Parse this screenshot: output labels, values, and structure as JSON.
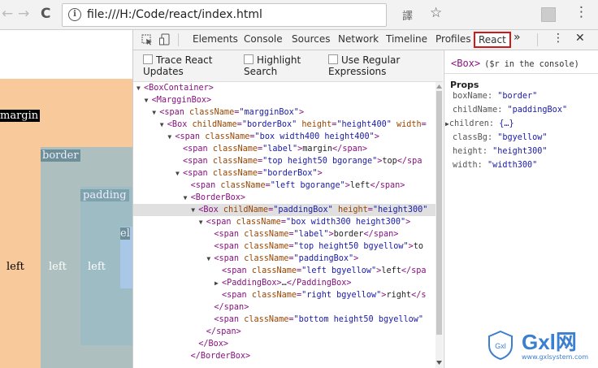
{
  "browser": {
    "back": "←",
    "forward": "→",
    "reload": "C",
    "info": "i",
    "url": "file:///H:/Code/react/index.html",
    "translate": "譯",
    "star": "☆",
    "menu": "⋮"
  },
  "page": {
    "margin_label": "margin",
    "border_label": "border",
    "padding_label": "padding",
    "partial_label": "el",
    "left1": "left",
    "left2": "left",
    "left3": "left",
    "colors": {
      "orange": "#f8c99a",
      "slate": "#9dbcc4",
      "blue": "#a9c8e8"
    }
  },
  "devtools": {
    "tabs": [
      "Elements",
      "Console",
      "Sources",
      "Network",
      "Timeline",
      "Profiles",
      "React"
    ],
    "more": "»",
    "kebab": "⋮",
    "close": "✕",
    "options": [
      {
        "line1": "Trace React",
        "line2": "Updates"
      },
      {
        "line1": "Highlight",
        "line2": "Search"
      },
      {
        "line1": "Use Regular",
        "line2": "Expressions"
      }
    ],
    "tree": [
      {
        "i": 0,
        "arrow": "▼",
        "p": [
          [
            "t",
            "<BoxContainer>"
          ]
        ]
      },
      {
        "i": 1,
        "arrow": "▼",
        "p": [
          [
            "t",
            "<MargginBox>"
          ]
        ]
      },
      {
        "i": 2,
        "arrow": "▼",
        "p": [
          [
            "t",
            "<span "
          ],
          [
            "a",
            "className"
          ],
          [
            "t",
            "="
          ],
          [
            "v",
            "\"margginBox\""
          ],
          [
            "t",
            ">"
          ]
        ]
      },
      {
        "i": 3,
        "arrow": "▼",
        "p": [
          [
            "t",
            "<Box "
          ],
          [
            "a",
            "childName"
          ],
          [
            "t",
            "="
          ],
          [
            "v",
            "\"borderBox\""
          ],
          [
            "t",
            " "
          ],
          [
            "a",
            "height"
          ],
          [
            "t",
            "="
          ],
          [
            "v",
            "\"height400\""
          ],
          [
            "t",
            " "
          ],
          [
            "a",
            "width"
          ],
          [
            "t",
            "="
          ]
        ]
      },
      {
        "i": 4,
        "arrow": "▼",
        "p": [
          [
            "t",
            "<span "
          ],
          [
            "a",
            "className"
          ],
          [
            "t",
            "="
          ],
          [
            "v",
            "\"box width400 height400\""
          ],
          [
            "t",
            ">"
          ]
        ]
      },
      {
        "i": 5,
        "arrow": "",
        "p": [
          [
            "t",
            "<span "
          ],
          [
            "a",
            "className"
          ],
          [
            "t",
            "="
          ],
          [
            "v",
            "\"label\""
          ],
          [
            "t",
            ">"
          ],
          [
            "x",
            "margin"
          ],
          [
            "t",
            "</span>"
          ]
        ]
      },
      {
        "i": 5,
        "arrow": "",
        "p": [
          [
            "t",
            "<span "
          ],
          [
            "a",
            "className"
          ],
          [
            "t",
            "="
          ],
          [
            "v",
            "\"top height50 bgorange\""
          ],
          [
            "t",
            ">"
          ],
          [
            "x",
            "top"
          ],
          [
            "t",
            "</spa"
          ]
        ]
      },
      {
        "i": 5,
        "arrow": "▼",
        "p": [
          [
            "t",
            "<span "
          ],
          [
            "a",
            "className"
          ],
          [
            "t",
            "="
          ],
          [
            "v",
            "\"borderBox\""
          ],
          [
            "t",
            ">"
          ]
        ]
      },
      {
        "i": 6,
        "arrow": "",
        "p": [
          [
            "t",
            "<span "
          ],
          [
            "a",
            "className"
          ],
          [
            "t",
            "="
          ],
          [
            "v",
            "\"left bgorange\""
          ],
          [
            "t",
            ">"
          ],
          [
            "x",
            "left"
          ],
          [
            "t",
            "</span>"
          ]
        ]
      },
      {
        "i": 6,
        "arrow": "▼",
        "p": [
          [
            "t",
            "<BorderBox>"
          ]
        ]
      },
      {
        "i": 7,
        "arrow": "▼",
        "sel": true,
        "p": [
          [
            "t",
            "<Box "
          ],
          [
            "a",
            "childName"
          ],
          [
            "t",
            "="
          ],
          [
            "v",
            "\"paddingBox\""
          ],
          [
            "t",
            " "
          ],
          [
            "a",
            "height"
          ],
          [
            "t",
            "="
          ],
          [
            "v",
            "\"height300\""
          ]
        ]
      },
      {
        "i": 8,
        "arrow": "▼",
        "p": [
          [
            "t",
            "<span "
          ],
          [
            "a",
            "className"
          ],
          [
            "t",
            "="
          ],
          [
            "v",
            "\"box width300 height300\""
          ],
          [
            "t",
            ">"
          ]
        ]
      },
      {
        "i": 9,
        "arrow": "",
        "p": [
          [
            "t",
            "<span "
          ],
          [
            "a",
            "className"
          ],
          [
            "t",
            "="
          ],
          [
            "v",
            "\"label\""
          ],
          [
            "t",
            ">"
          ],
          [
            "x",
            "border"
          ],
          [
            "t",
            "</span>"
          ]
        ]
      },
      {
        "i": 9,
        "arrow": "",
        "p": [
          [
            "t",
            "<span "
          ],
          [
            "a",
            "className"
          ],
          [
            "t",
            "="
          ],
          [
            "v",
            "\"top height50 bgyellow\""
          ],
          [
            "t",
            ">"
          ],
          [
            "x",
            "to"
          ]
        ]
      },
      {
        "i": 9,
        "arrow": "▼",
        "p": [
          [
            "t",
            "<span "
          ],
          [
            "a",
            "className"
          ],
          [
            "t",
            "="
          ],
          [
            "v",
            "\"paddingBox\""
          ],
          [
            "t",
            ">"
          ]
        ]
      },
      {
        "i": 10,
        "arrow": "",
        "p": [
          [
            "t",
            "<span "
          ],
          [
            "a",
            "className"
          ],
          [
            "t",
            "="
          ],
          [
            "v",
            "\"left bgyellow\""
          ],
          [
            "t",
            ">"
          ],
          [
            "x",
            "left"
          ],
          [
            "t",
            "</spa"
          ]
        ]
      },
      {
        "i": 10,
        "arrow": "▶",
        "p": [
          [
            "t",
            "<PaddingBox>"
          ],
          [
            "x",
            "…"
          ],
          [
            "t",
            "</PaddingBox>"
          ]
        ]
      },
      {
        "i": 10,
        "arrow": "",
        "p": [
          [
            "t",
            "<span "
          ],
          [
            "a",
            "className"
          ],
          [
            "t",
            "="
          ],
          [
            "v",
            "\"right bgyellow\""
          ],
          [
            "t",
            ">"
          ],
          [
            "x",
            "right"
          ],
          [
            "t",
            "</s"
          ]
        ]
      },
      {
        "i": 9,
        "arrow": "",
        "p": [
          [
            "t",
            "</span>"
          ]
        ]
      },
      {
        "i": 9,
        "arrow": "",
        "p": [
          [
            "t",
            "<span "
          ],
          [
            "a",
            "className"
          ],
          [
            "t",
            "="
          ],
          [
            "v",
            "\"bottom height50 bgyellow\""
          ]
        ]
      },
      {
        "i": 8,
        "arrow": "",
        "p": [
          [
            "t",
            "</span>"
          ]
        ]
      },
      {
        "i": 7,
        "arrow": "",
        "p": [
          [
            "t",
            "</Box>"
          ]
        ]
      },
      {
        "i": 6,
        "arrow": "",
        "p": [
          [
            "t",
            "</BorderBox>"
          ]
        ]
      }
    ],
    "side": {
      "tag": "<Box>",
      "hint": "($r in the console)",
      "props_title": "Props",
      "props": [
        {
          "key": "boxName",
          "val": "\"border\""
        },
        {
          "key": "childName",
          "val": "\"paddingBox\""
        },
        {
          "key": "children",
          "val": "{…}",
          "arrow": "▶"
        },
        {
          "key": "classBg",
          "val": "\"bgyellow\""
        },
        {
          "key": "height",
          "val": "\"height300\""
        },
        {
          "key": "width",
          "val": "\"width300\""
        }
      ]
    },
    "watermark": {
      "brand": "Gxl网",
      "shield": "Gxl",
      "url": "www.gxlsystem.com"
    }
  }
}
